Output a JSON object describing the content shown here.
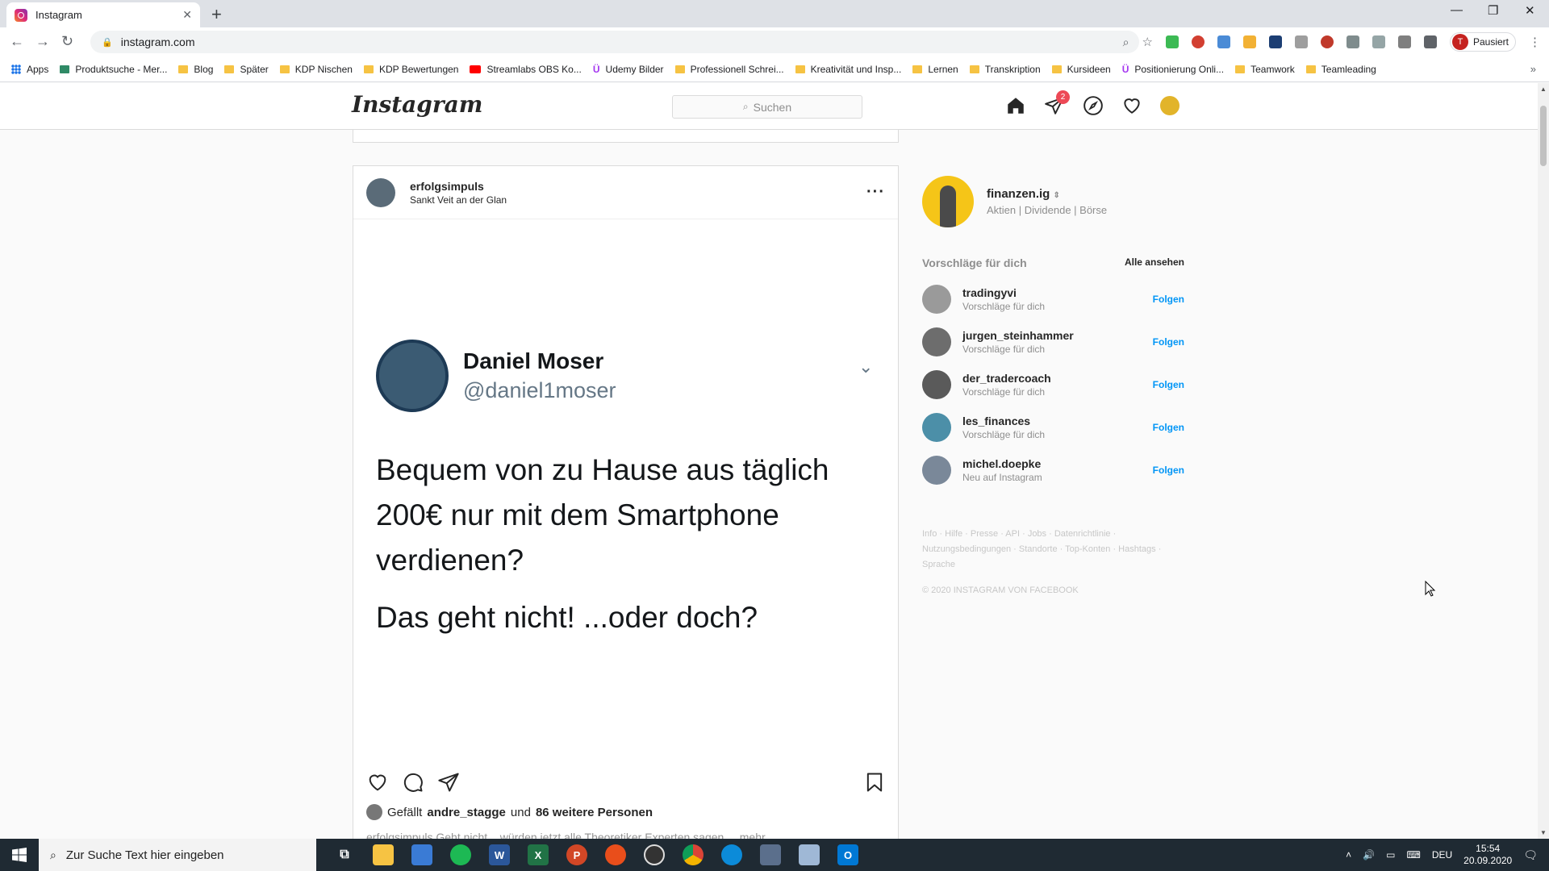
{
  "browser": {
    "tab_title": "Instagram",
    "url": "instagram.com",
    "profile_initial": "T",
    "profile_label": "Pausiert",
    "bookmarks": [
      {
        "label": "Apps",
        "icon": "apps-grid"
      },
      {
        "label": "Produktsuche - Mer...",
        "icon": "site"
      },
      {
        "label": "Blog",
        "icon": "folder"
      },
      {
        "label": "Später",
        "icon": "folder"
      },
      {
        "label": "KDP Nischen",
        "icon": "folder"
      },
      {
        "label": "KDP Bewertungen",
        "icon": "folder"
      },
      {
        "label": "Streamlabs OBS Ko...",
        "icon": "youtube"
      },
      {
        "label": "Udemy Bilder",
        "icon": "udemy"
      },
      {
        "label": "Professionell Schrei...",
        "icon": "folder"
      },
      {
        "label": "Kreativität und Insp...",
        "icon": "folder"
      },
      {
        "label": "Lernen",
        "icon": "folder"
      },
      {
        "label": "Transkription",
        "icon": "folder"
      },
      {
        "label": "Kursideen",
        "icon": "folder"
      },
      {
        "label": "Positionierung Onli...",
        "icon": "udemy"
      },
      {
        "label": "Teamwork",
        "icon": "folder"
      },
      {
        "label": "Teamleading",
        "icon": "folder"
      }
    ],
    "bookmarks_more": "»"
  },
  "instagram": {
    "logo": "Instagram",
    "search_placeholder": "Suchen",
    "direct_badge": "2",
    "post": {
      "username": "erfolgsimpuls",
      "location": "Sankt Veit an der Glan",
      "more": "···",
      "tweet": {
        "name": "Daniel Moser",
        "handle": "@daniel1moser",
        "line1": "Bequem von zu Hause aus täglich",
        "line2": "200€ nur mit dem Smartphone",
        "line3": "verdienen?",
        "line4": "Das geht nicht! ...oder doch?"
      },
      "likes_prefix": "Gefällt",
      "likes_user": "andre_stagge",
      "likes_middle": "und",
      "likes_rest": "86 weitere Personen",
      "caption": "erfolgsimpuls Geht nicht... würden jetzt alle Theoretiker Experten sagen ... mehr"
    },
    "sidebar": {
      "username": "finanzen.ig",
      "bio": "Aktien | Dividende | Börse",
      "suggestions_title": "Vorschläge für dich",
      "see_all": "Alle ansehen",
      "follow_label": "Folgen",
      "suggestions": [
        {
          "name": "tradingyvi",
          "sub": "Vorschläge für dich"
        },
        {
          "name": "jurgen_steinhammer",
          "sub": "Vorschläge für dich"
        },
        {
          "name": "der_tradercoach",
          "sub": "Vorschläge für dich"
        },
        {
          "name": "les_finances",
          "sub": "Vorschläge für dich"
        },
        {
          "name": "michel.doepke",
          "sub": "Neu auf Instagram"
        }
      ],
      "footer": "Info · Hilfe · Presse · API · Jobs · Datenrichtlinie · Nutzungsbedingungen · Standorte · Top-Konten · Hashtags · Sprache",
      "copyright": "© 2020 INSTAGRAM VON FACEBOOK"
    }
  },
  "taskbar": {
    "search_placeholder": "Zur Suche Text hier eingeben",
    "language": "DEU",
    "time": "15:54",
    "date": "20.09.2020"
  },
  "colors": {
    "instagram_blue": "#0095f6",
    "badge_red": "#ed4956"
  }
}
